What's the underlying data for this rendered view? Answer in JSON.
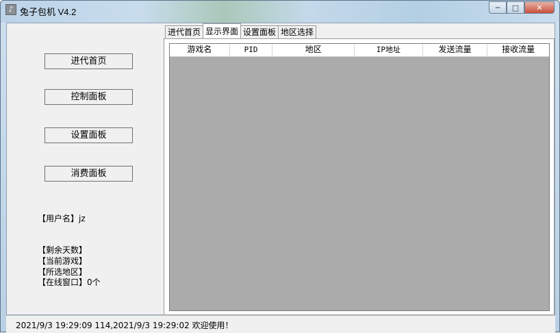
{
  "window": {
    "title": "兔子包机 V4.2",
    "icon": "app-icon",
    "minimize_icon": "minimize-icon",
    "maximize_icon": "maximize-icon",
    "close_icon": "close-icon"
  },
  "sidebar": {
    "buttons": [
      {
        "label": "进代首页"
      },
      {
        "label": "控制面板"
      },
      {
        "label": "设置面板"
      },
      {
        "label": "消费面板"
      }
    ],
    "user": "【用户名】jz",
    "remaining_days": "【剩余天数】",
    "current_game": "【当前游戏】",
    "selected_region": "【所选地区】",
    "online_windows": "【在线窗口】0个"
  },
  "tabs": [
    {
      "label": "进代首页",
      "active": false
    },
    {
      "label": "显示界面",
      "active": true
    },
    {
      "label": "设置面板",
      "active": false
    },
    {
      "label": "地区选择",
      "active": false
    }
  ],
  "listview": {
    "columns": [
      "游戏名",
      "PID",
      "地区",
      "IP地址",
      "发送流量",
      "接收流量"
    ],
    "rows": []
  },
  "status": {
    "text": "2021/9/3 19:29:09  114,2021/9/3 19:29:02  欢迎使用！"
  }
}
